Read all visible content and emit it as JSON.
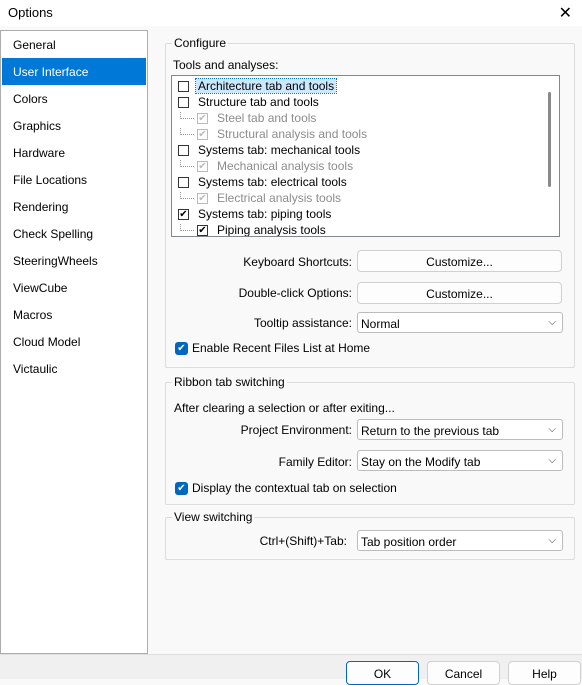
{
  "window": {
    "title": "Options",
    "close_icon": "close-icon"
  },
  "sidebar": {
    "items": [
      {
        "label": "General"
      },
      {
        "label": "User Interface",
        "selected": true
      },
      {
        "label": "Colors"
      },
      {
        "label": "Graphics"
      },
      {
        "label": "Hardware"
      },
      {
        "label": "File Locations"
      },
      {
        "label": "Rendering"
      },
      {
        "label": "Check Spelling"
      },
      {
        "label": "SteeringWheels"
      },
      {
        "label": "ViewCube"
      },
      {
        "label": "Macros"
      },
      {
        "label": "Cloud Model"
      },
      {
        "label": "Victaulic"
      }
    ]
  },
  "configure": {
    "title": "Configure",
    "tools_label": "Tools and analyses:",
    "tree": [
      {
        "label": "Architecture tab and tools",
        "checked": false,
        "level": 0,
        "enabled": true,
        "focused": true
      },
      {
        "label": "Structure tab and tools",
        "checked": false,
        "level": 0,
        "enabled": true
      },
      {
        "label": "Steel tab and tools",
        "checked": true,
        "level": 1,
        "enabled": false
      },
      {
        "label": "Structural analysis and tools",
        "checked": true,
        "level": 1,
        "enabled": false
      },
      {
        "label": "Systems tab: mechanical tools",
        "checked": false,
        "level": 0,
        "enabled": true
      },
      {
        "label": "Mechanical analysis tools",
        "checked": true,
        "level": 1,
        "enabled": false
      },
      {
        "label": "Systems tab: electrical tools",
        "checked": false,
        "level": 0,
        "enabled": true
      },
      {
        "label": "Electrical analysis tools",
        "checked": true,
        "level": 1,
        "enabled": false
      },
      {
        "label": "Systems tab: piping tools",
        "checked": true,
        "level": 0,
        "enabled": true
      },
      {
        "label": "Piping analysis tools",
        "checked": true,
        "level": 1,
        "enabled": true
      }
    ],
    "keyboard_label": "Keyboard Shortcuts:",
    "keyboard_button": "Customize...",
    "doubleclick_label": "Double-click Options:",
    "doubleclick_button": "Customize...",
    "tooltip_label": "Tooltip assistance:",
    "tooltip_value": "Normal",
    "recent_files": "Enable Recent Files List at Home"
  },
  "ribbon": {
    "title": "Ribbon tab switching",
    "after_label": "After clearing a selection or after exiting...",
    "project_label": "Project Environment:",
    "project_value": "Return to the previous tab",
    "family_label": "Family Editor:",
    "family_value": "Stay on the Modify tab",
    "contextual": "Display the contextual tab on selection"
  },
  "view": {
    "title": "View switching",
    "ctrl_label": "Ctrl+(Shift)+Tab:",
    "ctrl_value": "Tab position order"
  },
  "footer": {
    "ok": "OK",
    "cancel": "Cancel",
    "help": "Help"
  }
}
